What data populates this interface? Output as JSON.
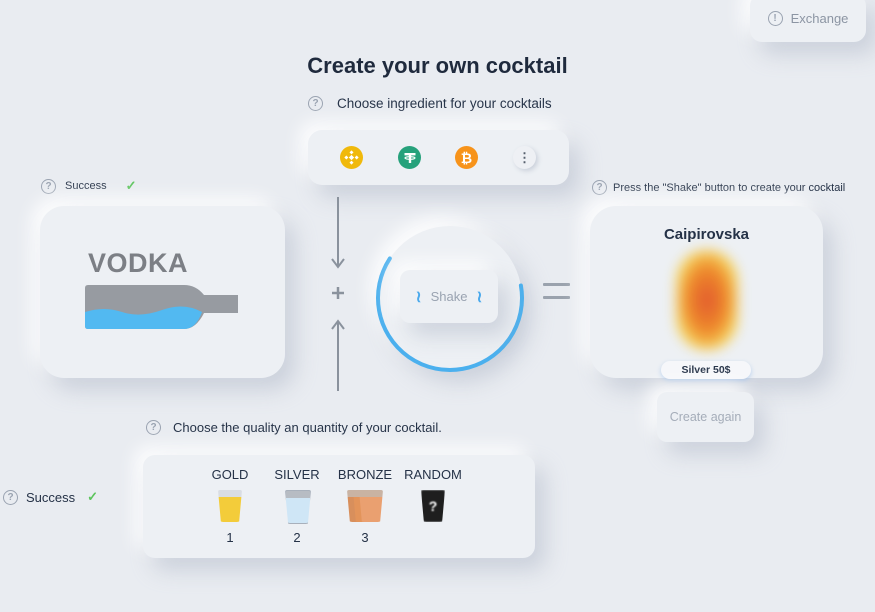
{
  "header": {
    "exchange_label": "Exchange",
    "title": "Create your own cocktail"
  },
  "ingredient": {
    "hint": "Choose ingredient for your cocktails",
    "coins": [
      {
        "icon": "binance-coin-icon",
        "color": "#f0b90b"
      },
      {
        "icon": "tether-coin-icon",
        "color": "#26a17b"
      },
      {
        "icon": "bitcoin-coin-icon",
        "color": "#f7931a"
      },
      {
        "icon": "more-options-icon",
        "color": "#eef0f4"
      }
    ]
  },
  "left": {
    "success_label": "Success",
    "card_label": "VODKA"
  },
  "mixer": {
    "plus": "+",
    "shake_label": "Shake",
    "progress": 0.62,
    "accent": "#4bb0ee"
  },
  "result": {
    "hint": "Press the \"Shake\" button to create your cocktail",
    "name": "Caipirovska",
    "price": "Silver 50$",
    "again_label": "Create again"
  },
  "quality": {
    "hint": "Choose the quality an quantity of your cocktail.",
    "success_label": "Success",
    "options": [
      {
        "label": "GOLD",
        "count": "1",
        "color": "#f3cc3a"
      },
      {
        "label": "SILVER",
        "count": "2",
        "color": "#cfe6f6"
      },
      {
        "label": "BRONZE",
        "count": "3",
        "color": "#e3945a"
      },
      {
        "label": "RANDOM",
        "count": "",
        "mark": "?",
        "color": "#1e1e1e"
      }
    ]
  }
}
